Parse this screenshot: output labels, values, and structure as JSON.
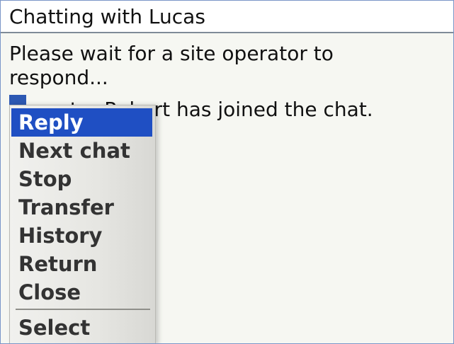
{
  "header": {
    "title": "Chatting with Lucas"
  },
  "chat": {
    "messages": [
      "Please wait for a site operator to",
      "respond...",
      "Operator Robert has joined the chat."
    ]
  },
  "context_menu": {
    "selected_index": 0,
    "items": [
      {
        "label": "Reply"
      },
      {
        "label": "Next chat"
      },
      {
        "label": "Stop"
      },
      {
        "label": "Transfer"
      },
      {
        "label": "History"
      },
      {
        "label": "Return"
      },
      {
        "label": "Close"
      },
      {
        "label": "Select"
      }
    ]
  },
  "colors": {
    "selection": "#1f4fc3",
    "cursor": "#2d59b3",
    "border": "#7a96c8",
    "chat_background": "#f6f7f2"
  }
}
